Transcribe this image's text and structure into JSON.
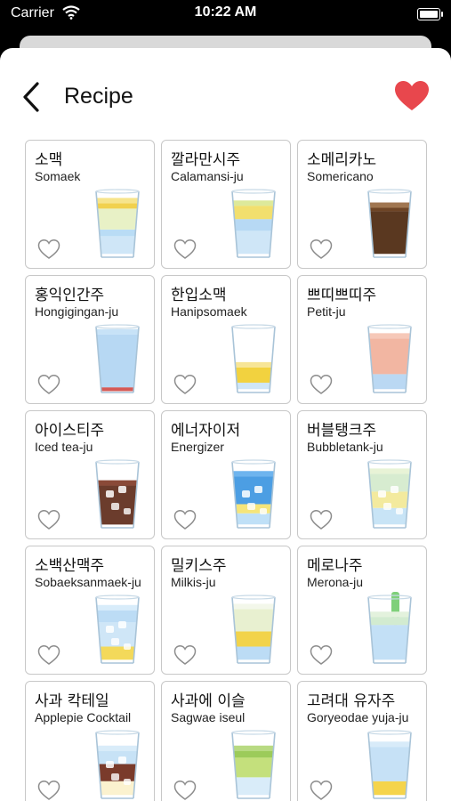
{
  "status": {
    "carrier": "Carrier",
    "time": "10:22 AM"
  },
  "nav": {
    "title": "Recipe",
    "favorite_icon": "heart-filled-icon",
    "back_icon": "chevron-left-icon"
  },
  "colors": {
    "favorite": "#e8474d",
    "card_border": "#c8c8c8"
  },
  "recipes": [
    {
      "kr": "소맥",
      "en": "Somaek",
      "glass": "yellow-beer"
    },
    {
      "kr": "깔라만시주",
      "en": "Calamansi-ju",
      "glass": "yellow-green-blue"
    },
    {
      "kr": "소메리카노",
      "en": "Somericano",
      "glass": "coffee"
    },
    {
      "kr": "홍익인간주",
      "en": "Hongigingan-ju",
      "glass": "blue-red"
    },
    {
      "kr": "한입소맥",
      "en": "Hanipsomaek",
      "glass": "yellow-half"
    },
    {
      "kr": "쁘띠쁘띠주",
      "en": "Petit-ju",
      "glass": "peach"
    },
    {
      "kr": "아이스티주",
      "en": "Iced tea-ju",
      "glass": "icedtea"
    },
    {
      "kr": "에너자이저",
      "en": "Energizer",
      "glass": "energizer"
    },
    {
      "kr": "버블탱크주",
      "en": "Bubbletank-ju",
      "glass": "bubble"
    },
    {
      "kr": "소백산맥주",
      "en": "Sobaeksanmaek-ju",
      "glass": "sobaek"
    },
    {
      "kr": "밀키스주",
      "en": "Milkis-ju",
      "glass": "milkis"
    },
    {
      "kr": "메로나주",
      "en": "Merona-ju",
      "glass": "merona"
    },
    {
      "kr": "사과 칵테일",
      "en": "Applepie Cocktail",
      "glass": "applepie"
    },
    {
      "kr": "사과에 이슬",
      "en": "Sagwae iseul",
      "glass": "sagwae"
    },
    {
      "kr": "고려대 유자주",
      "en": "Goryeodae yuja-ju",
      "glass": "yuja"
    }
  ]
}
